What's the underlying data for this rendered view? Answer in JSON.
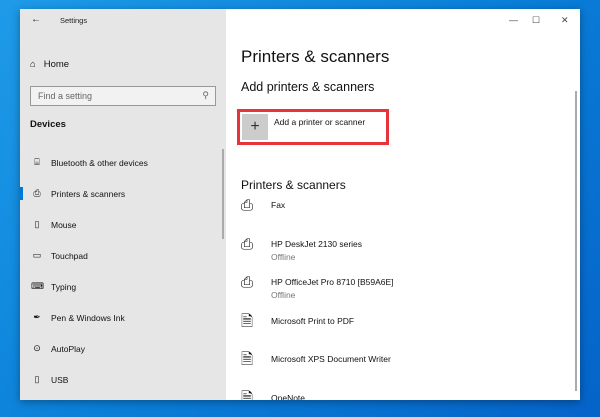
{
  "window": {
    "title": "Settings",
    "minimize": "—",
    "maximize": "☐",
    "close": "✕"
  },
  "sidebar": {
    "home": "Home",
    "search_placeholder": "Find a setting",
    "category": "Devices",
    "items": [
      {
        "icon": "bluetooth-icon",
        "glyph": "⌸",
        "label": "Bluetooth & other devices"
      },
      {
        "icon": "printer-icon",
        "glyph": "⎙",
        "label": "Printers & scanners",
        "selected": true
      },
      {
        "icon": "mouse-icon",
        "glyph": "▯",
        "label": "Mouse"
      },
      {
        "icon": "touchpad-icon",
        "glyph": "▭",
        "label": "Touchpad"
      },
      {
        "icon": "keyboard-icon",
        "glyph": "⌨",
        "label": "Typing"
      },
      {
        "icon": "pen-icon",
        "glyph": "✒",
        "label": "Pen & Windows Ink"
      },
      {
        "icon": "autoplay-icon",
        "glyph": "⊙",
        "label": "AutoPlay"
      },
      {
        "icon": "usb-icon",
        "glyph": "▯",
        "label": "USB"
      }
    ]
  },
  "main": {
    "title": "Printers & scanners",
    "add_heading": "Add printers & scanners",
    "add_button": "Add a printer or scanner",
    "add_glyph": "+",
    "list_heading": "Printers & scanners",
    "printers": [
      {
        "name": "Fax",
        "status": ""
      },
      {
        "name": "HP DeskJet 2130 series",
        "status": "Offline"
      },
      {
        "name": "HP OfficeJet Pro 8710 [B59A6E]",
        "status": "Offline"
      },
      {
        "name": "Microsoft Print to PDF",
        "status": ""
      },
      {
        "name": "Microsoft XPS Document Writer",
        "status": ""
      },
      {
        "name": "OneNote",
        "status": ""
      }
    ]
  }
}
